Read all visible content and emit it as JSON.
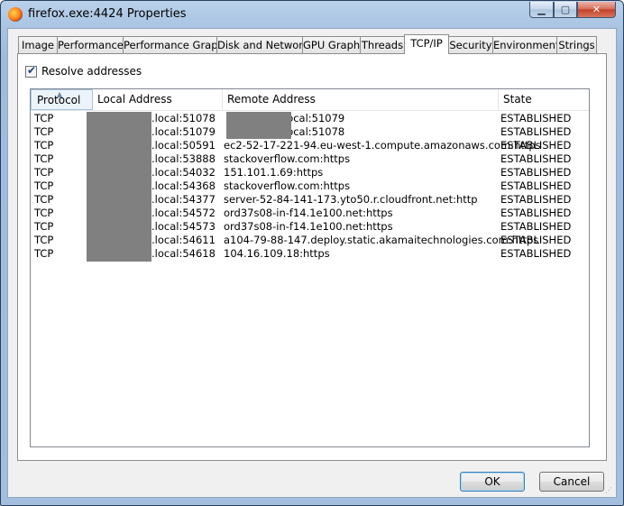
{
  "window": {
    "title": "firefox.exe:4424 Properties"
  },
  "tabs": [
    "Image",
    "Performance",
    "Performance Graph",
    "Disk and Network",
    "GPU Graph",
    "Threads",
    "TCP/IP",
    "Security",
    "Environment",
    "Strings"
  ],
  "active_tab": "TCP/IP",
  "options": {
    "resolve_label": "Resolve addresses",
    "resolve_checked": true
  },
  "table": {
    "columns": [
      "Protocol",
      "Local Address",
      "Remote Address",
      "State"
    ],
    "rows": [
      {
        "protocol": "TCP",
        "local": ".local:51078",
        "remote": "local:51079",
        "state": "ESTABLISHED"
      },
      {
        "protocol": "TCP",
        "local": ".local:51079",
        "remote": "local:51078",
        "state": "ESTABLISHED"
      },
      {
        "protocol": "TCP",
        "local": ".local:50591",
        "remote": "ec2-52-17-221-94.eu-west-1.compute.amazonaws.com:https",
        "state": "ESTABLISHED"
      },
      {
        "protocol": "TCP",
        "local": ".local:53888",
        "remote": "stackoverflow.com:https",
        "state": "ESTABLISHED"
      },
      {
        "protocol": "TCP",
        "local": ".local:54032",
        "remote": "151.101.1.69:https",
        "state": "ESTABLISHED"
      },
      {
        "protocol": "TCP",
        "local": ".local:54368",
        "remote": "stackoverflow.com:https",
        "state": "ESTABLISHED"
      },
      {
        "protocol": "TCP",
        "local": ".local:54377",
        "remote": "server-52-84-141-173.yto50.r.cloudfront.net:http",
        "state": "ESTABLISHED"
      },
      {
        "protocol": "TCP",
        "local": ".local:54572",
        "remote": "ord37s08-in-f14.1e100.net:https",
        "state": "ESTABLISHED"
      },
      {
        "protocol": "TCP",
        "local": ".local:54573",
        "remote": "ord37s08-in-f14.1e100.net:https",
        "state": "ESTABLISHED"
      },
      {
        "protocol": "TCP",
        "local": ".local:54611",
        "remote": "a104-79-88-147.deploy.static.akamaitechnologies.com:https",
        "state": "ESTABLISHED"
      },
      {
        "protocol": "TCP",
        "local": ".local:54618",
        "remote": "104.16.109.18:https",
        "state": "ESTABLISHED"
      }
    ]
  },
  "buttons": {
    "ok": "OK",
    "cancel": "Cancel"
  },
  "icons": {
    "window": "firefox-icon",
    "minimize": "minimize-icon",
    "maximize": "maximize-icon",
    "close": "close-icon"
  }
}
